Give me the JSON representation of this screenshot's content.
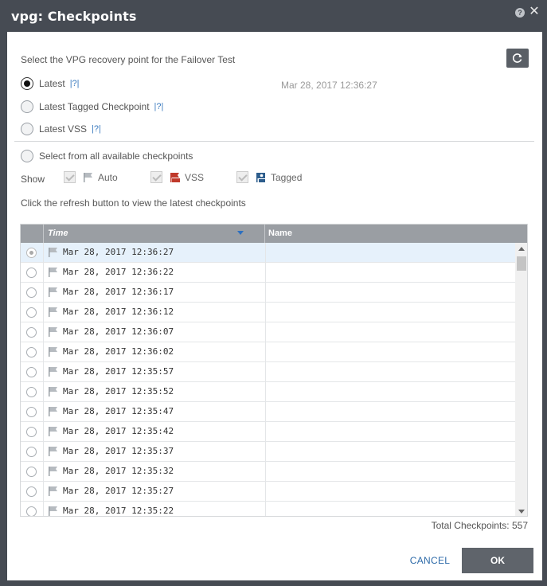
{
  "window": {
    "title": "vpg: Checkpoints",
    "help_label": "?",
    "close_label": "✕"
  },
  "intro": {
    "instruction": "Select the VPG recovery point for the Failover Test"
  },
  "options": {
    "latest": {
      "label": "Latest",
      "help": "|?|",
      "date": "Mar 28, 2017 12:36:27",
      "selected": true
    },
    "latest_tagged": {
      "label": "Latest Tagged Checkpoint",
      "help": "|?|"
    },
    "latest_vss": {
      "label": "Latest VSS",
      "help": "|?|"
    },
    "select_all": {
      "label": "Select from all available checkpoints"
    }
  },
  "filters": {
    "show_label": "Show",
    "auto_label": "Auto",
    "vss_label": "VSS",
    "tagged_label": "Tagged"
  },
  "hint": "Click the refresh button to view the latest checkpoints",
  "grid": {
    "col_time": "Time",
    "col_name": "Name",
    "rows": [
      {
        "time": "Mar 28, 2017 12:36:27",
        "name": ""
      },
      {
        "time": "Mar 28, 2017 12:36:22",
        "name": ""
      },
      {
        "time": "Mar 28, 2017 12:36:17",
        "name": ""
      },
      {
        "time": "Mar 28, 2017 12:36:12",
        "name": ""
      },
      {
        "time": "Mar 28, 2017 12:36:07",
        "name": ""
      },
      {
        "time": "Mar 28, 2017 12:36:02",
        "name": ""
      },
      {
        "time": "Mar 28, 2017 12:35:57",
        "name": ""
      },
      {
        "time": "Mar 28, 2017 12:35:52",
        "name": ""
      },
      {
        "time": "Mar 28, 2017 12:35:47",
        "name": ""
      },
      {
        "time": "Mar 28, 2017 12:35:42",
        "name": ""
      },
      {
        "time": "Mar 28, 2017 12:35:37",
        "name": ""
      },
      {
        "time": "Mar 28, 2017 12:35:32",
        "name": ""
      },
      {
        "time": "Mar 28, 2017 12:35:27",
        "name": ""
      },
      {
        "time": "Mar 28, 2017 12:35:22",
        "name": ""
      }
    ]
  },
  "total_checkpoints": "Total Checkpoints: 557",
  "buttons": {
    "cancel": "CANCEL",
    "ok": "OK"
  },
  "colors": {
    "titlebar": "#464b53",
    "accent_link": "#2d6aa8",
    "selected_row": "#e6f1fb",
    "vss_red": "#c0392b",
    "tagged_blue": "#2d5d8c"
  },
  "icons": {
    "refresh": "refresh-icon",
    "flag": "flag-icon",
    "vss": "vss-icon",
    "tagged": "tagged-icon",
    "sort": "sort-desc-icon"
  }
}
